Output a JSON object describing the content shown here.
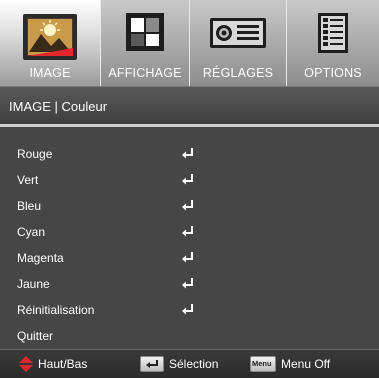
{
  "tabs": [
    {
      "label": "IMAGE",
      "icon": "image-icon",
      "active": true
    },
    {
      "label": "AFFICHAGE",
      "icon": "display-icon",
      "active": false
    },
    {
      "label": "RÉGLAGES",
      "icon": "projector-icon",
      "active": false
    },
    {
      "label": "OPTIONS",
      "icon": "options-icon",
      "active": false
    }
  ],
  "header": {
    "title": "IMAGE | Couleur"
  },
  "menu_items": [
    {
      "label": "Rouge",
      "has_enter": true
    },
    {
      "label": "Vert",
      "has_enter": true
    },
    {
      "label": "Bleu",
      "has_enter": true
    },
    {
      "label": "Cyan",
      "has_enter": true
    },
    {
      "label": "Magenta",
      "has_enter": true
    },
    {
      "label": "Jaune",
      "has_enter": true
    },
    {
      "label": "Réinitialisation",
      "has_enter": true
    },
    {
      "label": "Quitter",
      "has_enter": false
    }
  ],
  "footer": {
    "nav_label": "Haut/Bas",
    "select_label": "Sélection",
    "menu_key": "Menu",
    "menu_label": "Menu Off"
  },
  "colors": {
    "accent_red": "#e3262e",
    "background": "#454545",
    "text": "#ffffff"
  }
}
